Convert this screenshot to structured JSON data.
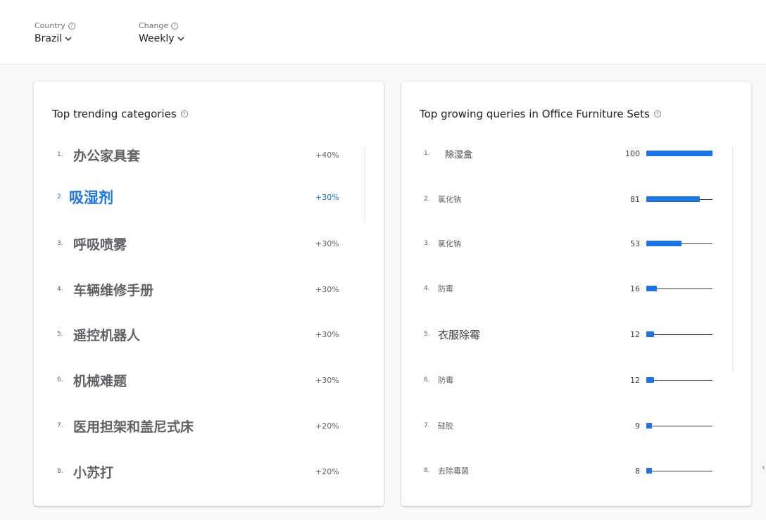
{
  "filters": {
    "country": {
      "label": "Country",
      "value": "Brazil"
    },
    "change": {
      "label": "Change",
      "value": "Weekly"
    }
  },
  "left_card": {
    "title": "Top trending categories",
    "items": [
      {
        "rank": "1.",
        "name": "办公家具套",
        "change": "+40%"
      },
      {
        "rank": "2",
        "name": "吸湿剂",
        "change": "+30%"
      },
      {
        "rank": "3.",
        "name": "呼吸喷雾",
        "change": "+30%"
      },
      {
        "rank": "4.",
        "name": "车辆维修手册",
        "change": "+30%"
      },
      {
        "rank": "5.",
        "name": "遥控机器人",
        "change": "+30%"
      },
      {
        "rank": "6.",
        "name": "机械难题",
        "change": "+30%"
      },
      {
        "rank": "7.",
        "name": "医用担架和盖尼式床",
        "change": "+20%"
      },
      {
        "rank": "8.",
        "name": "小苏打",
        "change": "+20%"
      }
    ]
  },
  "right_card": {
    "title": "Top growing queries in Office Furniture Sets",
    "items": [
      {
        "rank": "1.",
        "query": "除湿盒",
        "value": 100
      },
      {
        "rank": "2.",
        "query": "氯化钠",
        "value": 81
      },
      {
        "rank": "3.",
        "query": "氯化钠",
        "value": 53
      },
      {
        "rank": "4.",
        "query": "防霉",
        "value": 16
      },
      {
        "rank": "5.",
        "query": "衣服除霉",
        "value": 12
      },
      {
        "rank": "6.",
        "query": "防霉",
        "value": 12
      },
      {
        "rank": "7.",
        "query": "硅胶",
        "value": 9
      },
      {
        "rank": "8.",
        "query": "去除霉菌",
        "value": 8
      }
    ]
  },
  "colors": {
    "accent": "#1a73e8",
    "text": "#3c4043",
    "muted": "#5f6368"
  },
  "icons": {
    "help": "help-circle-icon",
    "dropdown": "chevron-down-icon",
    "edge": "arrow-icon"
  },
  "edge_glyph": "‹"
}
